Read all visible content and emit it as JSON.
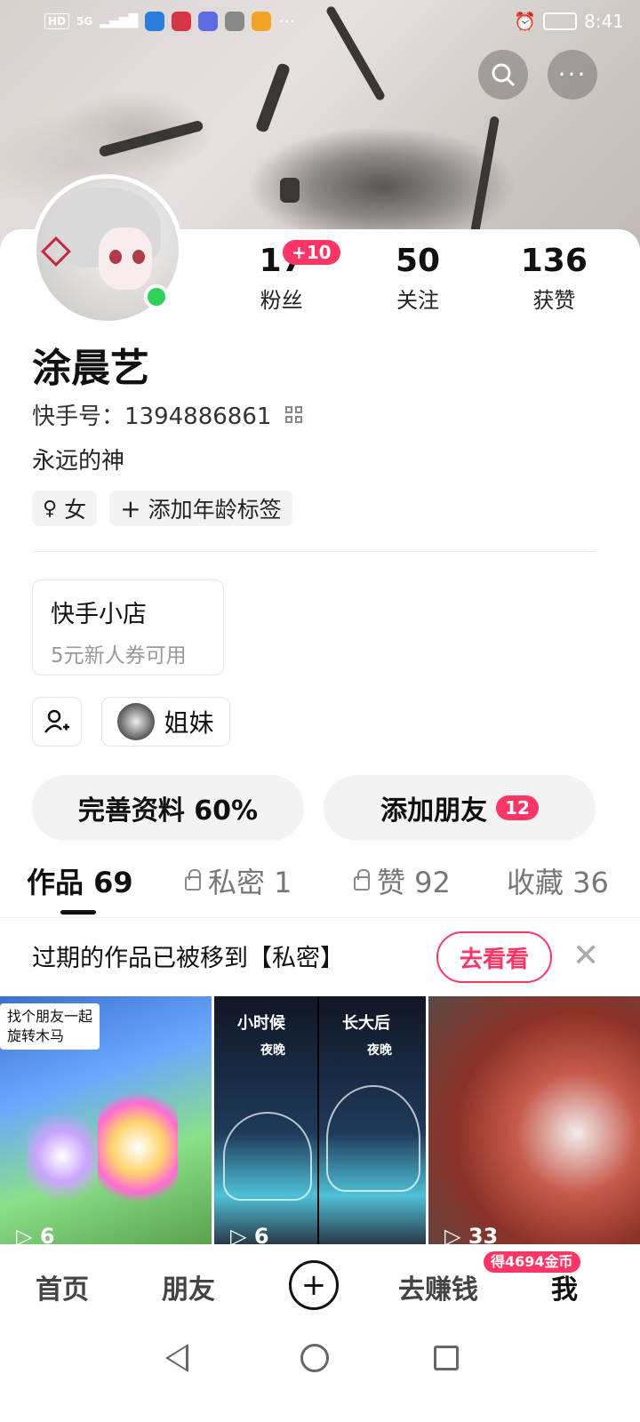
{
  "status": {
    "network": "HD",
    "signal": "5G",
    "time": "8:41"
  },
  "header": {
    "search_icon": "search-icon",
    "more_icon": "more-icon"
  },
  "profile": {
    "stats": [
      {
        "value": "17",
        "label": "粉丝"
      },
      {
        "value": "50",
        "label": "关注"
      },
      {
        "value": "136",
        "label": "获赞"
      }
    ],
    "fans_increase": "+10",
    "name": "涂晨艺",
    "kuaishou_id": "快手号：1394886861",
    "bio": "永远的神",
    "tags": [
      "女",
      "添加年龄标签"
    ]
  },
  "shop": {
    "title": "快手小店",
    "subtitle": "5元新人券可用"
  },
  "group": {
    "label": "姐妹"
  },
  "actions": {
    "complete_profile": "完善资料 60%",
    "add_friends": "添加朋友",
    "add_friends_count": "12"
  },
  "tabs": [
    {
      "label": "作品 69",
      "locked": false
    },
    {
      "label": "私密 1",
      "locked": true
    },
    {
      "label": "赞 92",
      "locked": true
    },
    {
      "label": "收藏 36",
      "locked": false
    }
  ],
  "notice": {
    "text": "过期的作品已被移到【私密】",
    "button": "去看看"
  },
  "videos": [
    {
      "overlay": "找个朋友一起\n旋转木马",
      "plays": "6"
    },
    {
      "overlay_left": "小时候",
      "overlay_right": "长大后",
      "sub": "夜晚",
      "plays": "6"
    },
    {
      "plays": "33"
    }
  ],
  "bottom_nav": [
    "首页",
    "朋友",
    "去赚钱",
    "我"
  ],
  "coin_badge": "得4694金币"
}
